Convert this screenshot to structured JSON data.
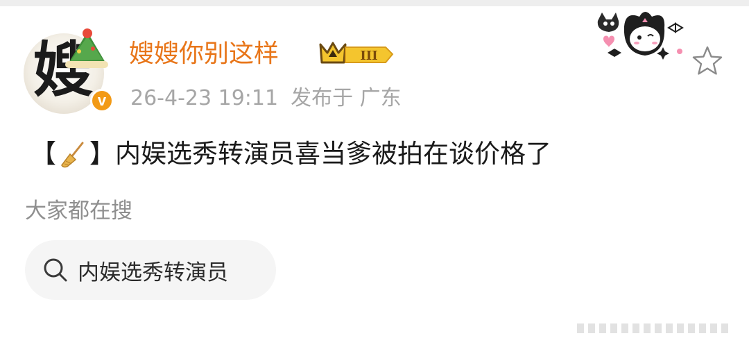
{
  "post": {
    "author": {
      "name": "嫂嫂你别这样",
      "avatar_glyph": "嫂",
      "verified_mark": "v",
      "rank_badge": "III"
    },
    "timestamp": "26-4-23 19:11",
    "location": "发布于 广东",
    "text_open": "【",
    "text_close": "】",
    "text_body": "内娱选秀转演员喜当爹被拍在谈价格了"
  },
  "related": {
    "label": "大家都在搜",
    "chip": "内娱选秀转演员"
  },
  "colors": {
    "username": "#e8761a",
    "meta": "#a6a6a6",
    "badge_gold": "#f4c52e",
    "chip_bg": "#f5f5f5"
  },
  "icons": [
    "broom-icon",
    "search-icon",
    "star-icon",
    "verified-badge-icon",
    "crown-icon"
  ]
}
